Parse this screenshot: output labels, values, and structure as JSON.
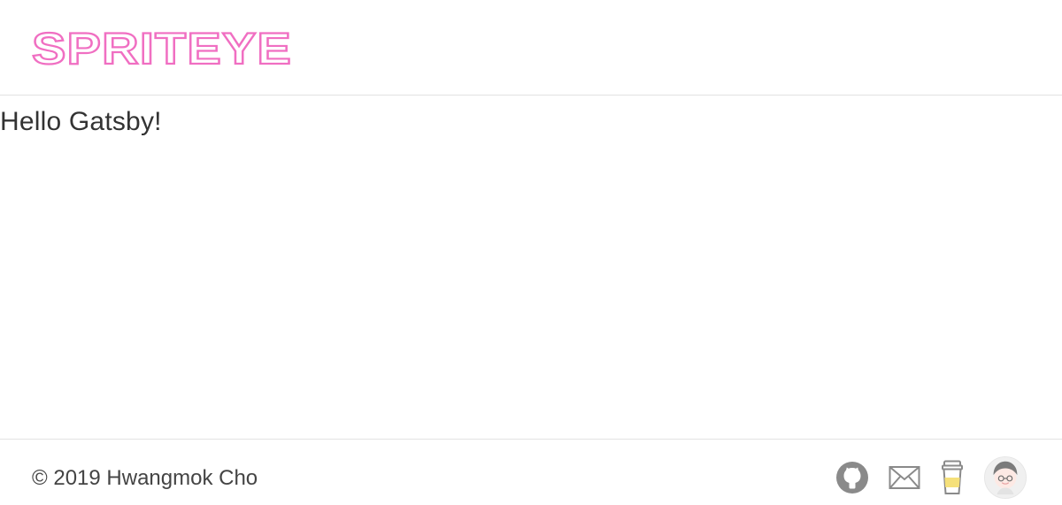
{
  "header": {
    "logo_text": "SPRITEYE",
    "logo_color": "#f06fc2"
  },
  "main": {
    "greeting": "Hello Gatsby!"
  },
  "footer": {
    "copyright": "© 2019 Hwangmok Cho",
    "icons": [
      {
        "name": "github-icon",
        "color": "#8a8a8a"
      },
      {
        "name": "mail-icon",
        "color": "#8a8a8a"
      },
      {
        "name": "coffee-cup-icon",
        "color": "#f5e07a"
      },
      {
        "name": "avatar",
        "color": "#cfcfcf"
      }
    ]
  }
}
